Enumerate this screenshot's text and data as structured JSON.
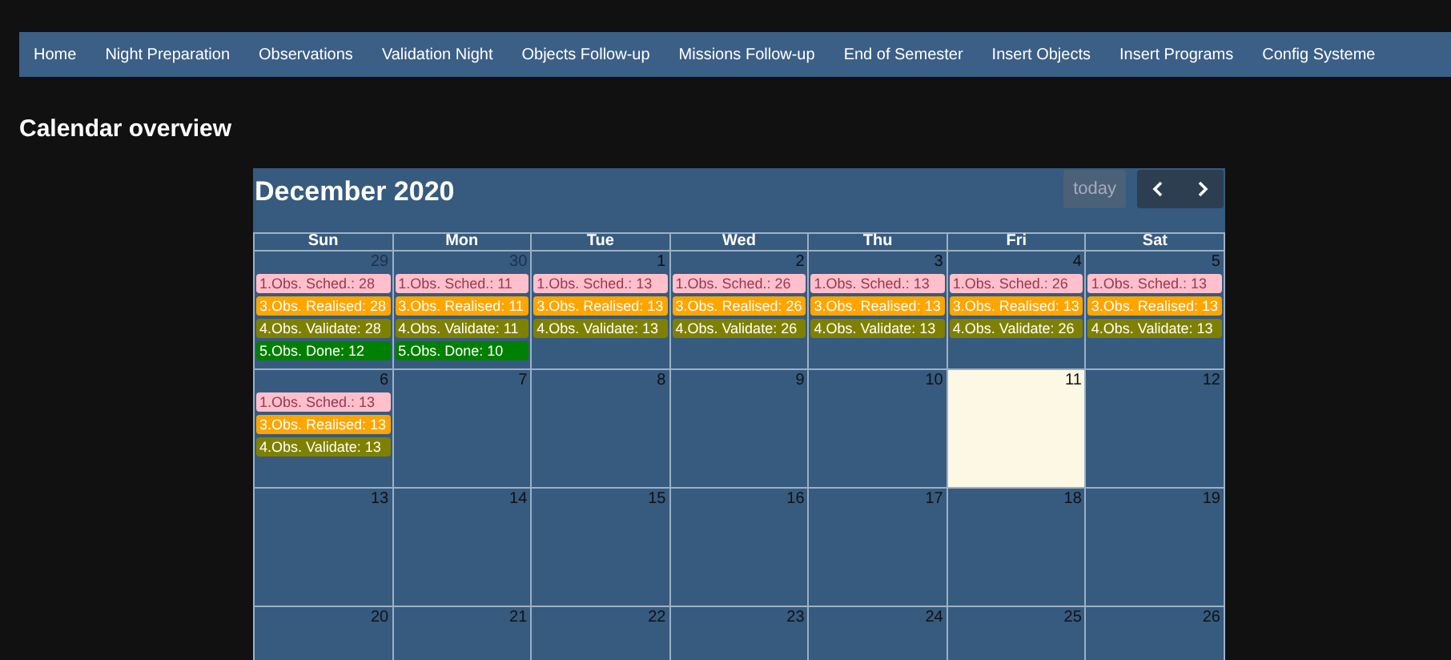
{
  "nav": [
    {
      "label": "Home"
    },
    {
      "label": "Night Preparation"
    },
    {
      "label": "Observations"
    },
    {
      "label": "Validation Night"
    },
    {
      "label": "Objects Follow-up"
    },
    {
      "label": "Missions Follow-up"
    },
    {
      "label": "End of Semester"
    },
    {
      "label": "Insert Objects"
    },
    {
      "label": "Insert Programs"
    },
    {
      "label": "Config Systeme"
    }
  ],
  "heading": "Calendar overview",
  "calendar": {
    "title": "December 2020",
    "today_button": "today",
    "weekdays": [
      "Sun",
      "Mon",
      "Tue",
      "Wed",
      "Thu",
      "Fri",
      "Sat"
    ],
    "weeks": [
      [
        {
          "day": "29",
          "other_month": true,
          "today": false,
          "events": [
            {
              "label": "1.Obs. Sched.: 28",
              "color": "#ffc0cb"
            },
            {
              "label": "3.Obs. Realised: 28",
              "color": "#ffa500"
            },
            {
              "label": "4.Obs. Validate: 28",
              "color": "#808000"
            },
            {
              "label": "5.Obs. Done: 12",
              "color": "#008000"
            }
          ]
        },
        {
          "day": "30",
          "other_month": true,
          "today": false,
          "events": [
            {
              "label": "1.Obs. Sched.: 11",
              "color": "#ffc0cb"
            },
            {
              "label": "3.Obs. Realised: 11",
              "color": "#ffa500"
            },
            {
              "label": "4.Obs. Validate: 11",
              "color": "#808000"
            },
            {
              "label": "5.Obs. Done: 10",
              "color": "#008000"
            }
          ]
        },
        {
          "day": "1",
          "other_month": false,
          "today": false,
          "events": [
            {
              "label": "1.Obs. Sched.: 13",
              "color": "#ffc0cb"
            },
            {
              "label": "3.Obs. Realised: 13",
              "color": "#ffa500"
            },
            {
              "label": "4.Obs. Validate: 13",
              "color": "#808000"
            }
          ]
        },
        {
          "day": "2",
          "other_month": false,
          "today": false,
          "events": [
            {
              "label": "1.Obs. Sched.: 26",
              "color": "#ffc0cb"
            },
            {
              "label": "3.Obs. Realised: 26",
              "color": "#ffa500"
            },
            {
              "label": "4.Obs. Validate: 26",
              "color": "#808000"
            }
          ]
        },
        {
          "day": "3",
          "other_month": false,
          "today": false,
          "events": [
            {
              "label": "1.Obs. Sched.: 13",
              "color": "#ffc0cb"
            },
            {
              "label": "3.Obs. Realised: 13",
              "color": "#ffa500"
            },
            {
              "label": "4.Obs. Validate: 13",
              "color": "#808000"
            }
          ]
        },
        {
          "day": "4",
          "other_month": false,
          "today": false,
          "events": [
            {
              "label": "1.Obs. Sched.: 26",
              "color": "#ffc0cb"
            },
            {
              "label": "3.Obs. Realised: 13",
              "color": "#ffa500"
            },
            {
              "label": "4.Obs. Validate: 26",
              "color": "#808000"
            }
          ]
        },
        {
          "day": "5",
          "other_month": false,
          "today": false,
          "events": [
            {
              "label": "1.Obs. Sched.: 13",
              "color": "#ffc0cb"
            },
            {
              "label": "3.Obs. Realised: 13",
              "color": "#ffa500"
            },
            {
              "label": "4.Obs. Validate: 13",
              "color": "#808000"
            }
          ]
        }
      ],
      [
        {
          "day": "6",
          "other_month": false,
          "today": false,
          "events": [
            {
              "label": "1.Obs. Sched.: 13",
              "color": "#ffc0cb"
            },
            {
              "label": "3.Obs. Realised: 13",
              "color": "#ffa500"
            },
            {
              "label": "4.Obs. Validate: 13",
              "color": "#808000"
            }
          ]
        },
        {
          "day": "7",
          "other_month": false,
          "today": false
        },
        {
          "day": "8",
          "other_month": false,
          "today": false
        },
        {
          "day": "9",
          "other_month": false,
          "today": false
        },
        {
          "day": "10",
          "other_month": false,
          "today": false
        },
        {
          "day": "11",
          "other_month": false,
          "today": true
        },
        {
          "day": "12",
          "other_month": false,
          "today": false
        }
      ],
      [
        {
          "day": "13",
          "other_month": false,
          "today": false
        },
        {
          "day": "14",
          "other_month": false,
          "today": false
        },
        {
          "day": "15",
          "other_month": false,
          "today": false
        },
        {
          "day": "16",
          "other_month": false,
          "today": false
        },
        {
          "day": "17",
          "other_month": false,
          "today": false
        },
        {
          "day": "18",
          "other_month": false,
          "today": false
        },
        {
          "day": "19",
          "other_month": false,
          "today": false
        }
      ],
      [
        {
          "day": "20",
          "other_month": false,
          "today": false
        },
        {
          "day": "21",
          "other_month": false,
          "today": false
        },
        {
          "day": "22",
          "other_month": false,
          "today": false
        },
        {
          "day": "23",
          "other_month": false,
          "today": false
        },
        {
          "day": "24",
          "other_month": false,
          "today": false
        },
        {
          "day": "25",
          "other_month": false,
          "today": false
        },
        {
          "day": "26",
          "other_month": false,
          "today": false
        }
      ]
    ]
  }
}
